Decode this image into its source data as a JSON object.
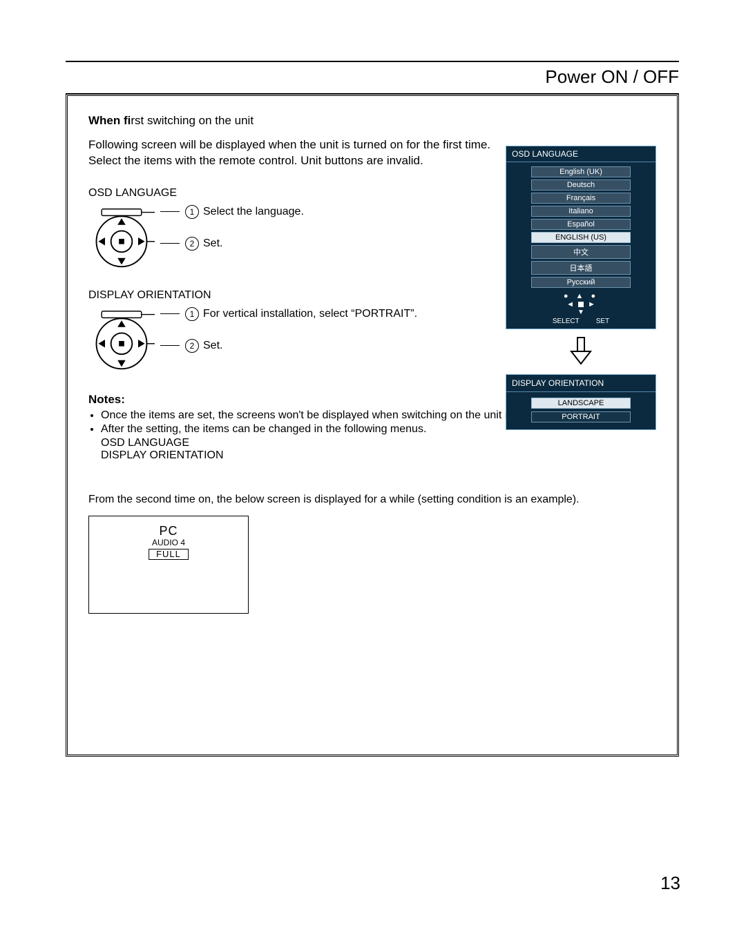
{
  "header": {
    "title": "Power ON / OFF"
  },
  "intro": {
    "heading_prefix": "When ",
    "heading_bold": "fi",
    "heading_rest": "rst switching on the unit",
    "line1": "Following screen will be displayed when the unit is turned on for the first time.",
    "line2": "Select the items with the remote control. Unit buttons are invalid."
  },
  "sections": {
    "osd_language": {
      "label": "OSD LANGUAGE",
      "step1": "Select the language.",
      "step2": "Set."
    },
    "display_orientation": {
      "label": "DISPLAY ORIENTATION",
      "step1": "For vertical installation, select “PORTRAIT”.",
      "step2": "Set."
    }
  },
  "notes": {
    "heading": "Notes:",
    "items": [
      "Once the items are set, the screens won't be displayed when switching on the unit next time.",
      "After the setting, the items can be changed in the following menus."
    ],
    "sub1": "OSD LANGUAGE",
    "sub2": "DISPLAY ORIENTATION"
  },
  "second_time": {
    "text": "From the second time on, the below screen is displayed for a while (setting condition is an example).",
    "status": {
      "line1": "PC",
      "line2": "AUDIO 4",
      "line3": "FULL"
    }
  },
  "osd_menu": {
    "title": "OSD LANGUAGE",
    "items": [
      {
        "label": "English (UK)",
        "selected": false
      },
      {
        "label": "Deutsch",
        "selected": false
      },
      {
        "label": "Français",
        "selected": false
      },
      {
        "label": "Italiano",
        "selected": false
      },
      {
        "label": "Español",
        "selected": false
      },
      {
        "label": "ENGLISH (US)",
        "selected": true
      },
      {
        "label": "中文",
        "selected": false
      },
      {
        "label": "日本語",
        "selected": false
      },
      {
        "label": "Русский",
        "selected": false
      }
    ],
    "nav": {
      "select": "SELECT",
      "set": "SET"
    }
  },
  "orientation_menu": {
    "title": "DISPLAY ORIENTATION",
    "items": [
      {
        "label": "LANDSCAPE",
        "selected": true
      },
      {
        "label": "PORTRAIT",
        "selected": false
      }
    ]
  },
  "page_number": "13"
}
